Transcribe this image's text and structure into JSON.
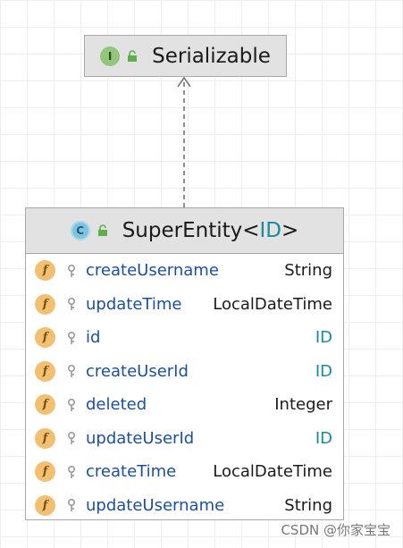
{
  "interface": {
    "badge": "I",
    "name": "Serializable",
    "badge_icon": "interface-badge-icon",
    "lock_icon": "unlock-icon"
  },
  "class": {
    "badge": "C",
    "name": "SuperEntity",
    "type_open": "<",
    "type_param": "ID",
    "type_close": ">",
    "fields": [
      {
        "name": "createUsername",
        "type": "String",
        "generic": false
      },
      {
        "name": "updateTime",
        "type": "LocalDateTime",
        "generic": false
      },
      {
        "name": "id",
        "type": "ID",
        "generic": true
      },
      {
        "name": "createUserId",
        "type": "ID",
        "generic": true
      },
      {
        "name": "deleted",
        "type": "Integer",
        "generic": false
      },
      {
        "name": "updateUserId",
        "type": "ID",
        "generic": true
      },
      {
        "name": "createTime",
        "type": "LocalDateTime",
        "generic": false
      },
      {
        "name": "updateUsername",
        "type": "String",
        "generic": false
      }
    ],
    "field_badge": "f"
  },
  "relation": {
    "type": "implements",
    "style": "dashed"
  },
  "colors": {
    "field_name": "#1d4f9c",
    "generic_type": "#1a8a9a",
    "header_bg": "#e2e2e2"
  },
  "watermark": "CSDN @你家宝宝"
}
